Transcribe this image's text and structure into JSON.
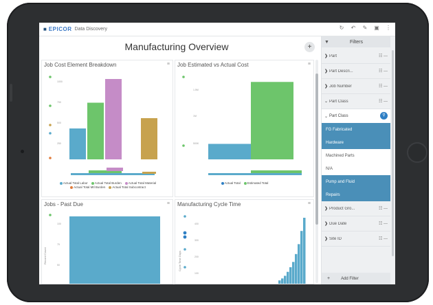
{
  "app": {
    "brand": "EPICOR",
    "product": "Data Discovery",
    "logo_icon": "home-icon",
    "top_icons": [
      "refresh-icon",
      "undo-icon",
      "edit-icon",
      "save-icon",
      "more-icon"
    ]
  },
  "page": {
    "title": "Manufacturing Overview",
    "add_label": "+"
  },
  "panels": {
    "p1_title": "Job Cost Element Breakdown",
    "p2_title": "Job Estimated vs Actual Cost",
    "p3_title": "Jobs - Past Due",
    "p4_title": "Manufacturing Cycle Time",
    "menu_glyph": "≡"
  },
  "filters": {
    "title": "Filters",
    "items": [
      {
        "label": "Part",
        "state": "collapsed"
      },
      {
        "label": "Part Descri...",
        "state": "collapsed"
      },
      {
        "label": "Job Number",
        "state": "collapsed"
      },
      {
        "label": "Part Class",
        "state": "expanded"
      }
    ],
    "part_class_header": "Part Class",
    "part_class_options": [
      {
        "label": "FG Fabricated",
        "selected": true
      },
      {
        "label": "Hardware",
        "selected": true
      },
      {
        "label": "Machined Parts",
        "selected": false
      },
      {
        "label": "N/A",
        "selected": false
      },
      {
        "label": "Pump and Fluid",
        "selected": true
      },
      {
        "label": "Repairs",
        "selected": true
      }
    ],
    "more_items": [
      {
        "label": "Product Gro..."
      },
      {
        "label": "Due Date"
      },
      {
        "label": "Site ID"
      }
    ],
    "add_filter": "Add Filter"
  },
  "colors": {
    "blue": "#5aaacb",
    "green": "#6dc56b",
    "purple": "#c58cc7",
    "gold": "#c7a24e",
    "selected": "#4a8fb8"
  },
  "chart_data": [
    {
      "type": "bar",
      "title": "Job Cost Element Breakdown",
      "series": [
        {
          "name": "Actual Total Labor",
          "values": [
            30
          ]
        },
        {
          "name": "Actual Total Burden",
          "values": [
            55
          ]
        },
        {
          "name": "Actual Total Material",
          "values": [
            78
          ]
        },
        {
          "name": "Actual Total Mtl Burden",
          "values": [
            0
          ]
        },
        {
          "name": "Actual Total Subcontract",
          "values": [
            40
          ]
        }
      ],
      "legend": [
        "Actual Total Labor",
        "Actual Total Burden",
        "Actual Total Material",
        "Actual Total Mtl Burden",
        "Actual Total Subcontract"
      ],
      "ylim": [
        0,
        80
      ]
    },
    {
      "type": "bar",
      "title": "Job Estimated vs Actual Cost",
      "series": [
        {
          "name": "Actual Total",
          "values": [
            20
          ]
        },
        {
          "name": "Estimated Total",
          "values": [
            100
          ]
        }
      ],
      "legend": [
        "Actual Total",
        "Estimated Total"
      ],
      "ylim": [
        0,
        110
      ]
    },
    {
      "type": "bar",
      "title": "Jobs - Past Due",
      "values": [
        100
      ],
      "ylabel": "Record Count",
      "ylim": [
        0,
        100
      ]
    },
    {
      "type": "bar",
      "title": "Manufacturing Cycle Time",
      "ylabel": "Cycle Time Days",
      "values": [
        5,
        8,
        12,
        18,
        25,
        33,
        45,
        60,
        80,
        100
      ],
      "ylim": [
        0,
        100
      ]
    }
  ]
}
